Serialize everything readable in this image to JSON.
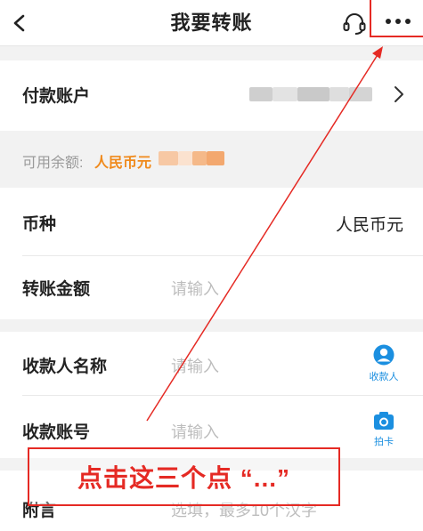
{
  "header": {
    "title": "我要转账",
    "back_icon": "chevron-left-icon",
    "service_icon": "headset-icon",
    "more_icon": "more-dots-icon"
  },
  "payment_account": {
    "label": "付款账户",
    "chevron_icon": "chevron-right-icon"
  },
  "balance": {
    "label": "可用余额:",
    "currency": "人民币元"
  },
  "currency_row": {
    "label": "币种",
    "value": "人民币元"
  },
  "amount_row": {
    "label": "转账金额",
    "placeholder": "请输入"
  },
  "payee_name_row": {
    "label": "收款人名称",
    "placeholder": "请输入",
    "button_label": "收款人",
    "button_icon": "contact-icon"
  },
  "payee_account_row": {
    "label": "收款账号",
    "placeholder": "请输入",
    "button_label": "拍卡",
    "button_icon": "camera-icon"
  },
  "note_row": {
    "label": "附言",
    "placeholder": "选填，最多10个汉字"
  },
  "annotation": {
    "text": "点击这三个点 “...”"
  },
  "colors": {
    "accent_blue": "#1b8fe0",
    "balance_orange": "#f08a1c",
    "annotation_red": "#e52a24"
  }
}
